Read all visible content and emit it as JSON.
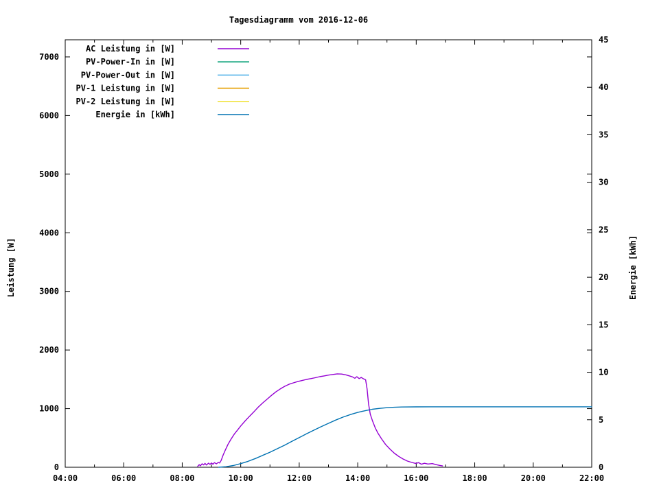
{
  "chart_data": {
    "type": "line",
    "title": "Tagesdiagramm vom 2016-12-06",
    "x_axis": {
      "range": [
        4,
        22
      ],
      "major_hours": [
        4,
        6,
        8,
        10,
        12,
        14,
        16,
        18,
        20,
        22
      ],
      "tick_labels": [
        "04:00",
        "06:00",
        "08:00",
        "10:00",
        "12:00",
        "14:00",
        "16:00",
        "18:00",
        "20:00",
        "22:00"
      ],
      "minor_hours": [
        5,
        7,
        9,
        11,
        13,
        15,
        17,
        19,
        21
      ]
    },
    "y_left": {
      "title": "Leistung [W]",
      "range": [
        0,
        7292
      ],
      "ticks": [
        0,
        1000,
        2000,
        3000,
        4000,
        5000,
        6000,
        7000
      ],
      "tick_labels": [
        "0",
        "1000",
        "2000",
        "3000",
        "4000",
        "5000",
        "6000",
        "7000"
      ]
    },
    "y_right": {
      "title": "Energie [kWh]",
      "range": [
        0,
        45
      ],
      "ticks": [
        0,
        5,
        10,
        15,
        20,
        25,
        30,
        35,
        40,
        45
      ],
      "tick_labels": [
        "0",
        "5",
        "10",
        "15",
        "20",
        "25",
        "30",
        "35",
        "40",
        "45"
      ]
    },
    "legend_position": "top-left-inside",
    "grid": false,
    "series": [
      {
        "name": "AC Leistung in [W]",
        "color": "#9400d3",
        "axis": "left",
        "points": [
          [
            8.53,
            15
          ],
          [
            8.58,
            45
          ],
          [
            8.62,
            25
          ],
          [
            8.68,
            60
          ],
          [
            8.73,
            40
          ],
          [
            8.78,
            65
          ],
          [
            8.83,
            38
          ],
          [
            8.9,
            70
          ],
          [
            8.95,
            48
          ],
          [
            9.0,
            72
          ],
          [
            9.05,
            50
          ],
          [
            9.1,
            78
          ],
          [
            9.17,
            58
          ],
          [
            9.23,
            82
          ],
          [
            9.28,
            72
          ],
          [
            9.33,
            115
          ],
          [
            9.4,
            210
          ],
          [
            9.48,
            300
          ],
          [
            9.57,
            395
          ],
          [
            9.67,
            480
          ],
          [
            9.78,
            565
          ],
          [
            9.9,
            640
          ],
          [
            10.0,
            705
          ],
          [
            10.15,
            790
          ],
          [
            10.3,
            870
          ],
          [
            10.45,
            945
          ],
          [
            10.6,
            1025
          ],
          [
            10.75,
            1095
          ],
          [
            10.9,
            1160
          ],
          [
            11.05,
            1225
          ],
          [
            11.2,
            1285
          ],
          [
            11.35,
            1335
          ],
          [
            11.5,
            1380
          ],
          [
            11.65,
            1415
          ],
          [
            11.8,
            1440
          ],
          [
            11.95,
            1462
          ],
          [
            12.1,
            1480
          ],
          [
            12.25,
            1498
          ],
          [
            12.4,
            1512
          ],
          [
            12.55,
            1528
          ],
          [
            12.7,
            1545
          ],
          [
            12.85,
            1558
          ],
          [
            13.0,
            1572
          ],
          [
            13.15,
            1583
          ],
          [
            13.3,
            1593
          ],
          [
            13.45,
            1590
          ],
          [
            13.6,
            1575
          ],
          [
            13.72,
            1558
          ],
          [
            13.82,
            1542
          ],
          [
            13.9,
            1518
          ],
          [
            13.97,
            1545
          ],
          [
            14.05,
            1512
          ],
          [
            14.12,
            1532
          ],
          [
            14.2,
            1508
          ],
          [
            14.27,
            1492
          ],
          [
            14.32,
            1340
          ],
          [
            14.37,
            1080
          ],
          [
            14.43,
            905
          ],
          [
            14.5,
            800
          ],
          [
            14.6,
            670
          ],
          [
            14.7,
            575
          ],
          [
            14.82,
            480
          ],
          [
            14.95,
            390
          ],
          [
            15.1,
            310
          ],
          [
            15.25,
            240
          ],
          [
            15.4,
            185
          ],
          [
            15.55,
            140
          ],
          [
            15.7,
            105
          ],
          [
            15.85,
            82
          ],
          [
            15.98,
            65
          ],
          [
            16.08,
            78
          ],
          [
            16.18,
            52
          ],
          [
            16.28,
            68
          ],
          [
            16.4,
            55
          ],
          [
            16.55,
            62
          ],
          [
            16.68,
            45
          ],
          [
            16.8,
            32
          ],
          [
            16.9,
            22
          ]
        ]
      },
      {
        "name": "PV-Power-In in [W]",
        "color": "#009e73",
        "axis": "left",
        "points": []
      },
      {
        "name": "PV-Power-Out in [W]",
        "color": "#56b4e9",
        "axis": "left",
        "points": []
      },
      {
        "name": "PV-1 Leistung in [W]",
        "color": "#e69f00",
        "axis": "left",
        "points": []
      },
      {
        "name": "PV-2 Leistung in [W]",
        "color": "#f0e442",
        "axis": "left",
        "points": []
      },
      {
        "name": "Energie in [kWh]",
        "color": "#0072b2",
        "axis": "right",
        "points": [
          [
            9.25,
            0
          ],
          [
            9.5,
            0.06
          ],
          [
            9.75,
            0.18
          ],
          [
            10.0,
            0.38
          ],
          [
            10.25,
            0.62
          ],
          [
            10.5,
            0.92
          ],
          [
            10.75,
            1.25
          ],
          [
            11.0,
            1.58
          ],
          [
            11.25,
            1.95
          ],
          [
            11.5,
            2.32
          ],
          [
            11.75,
            2.72
          ],
          [
            12.0,
            3.12
          ],
          [
            12.25,
            3.52
          ],
          [
            12.5,
            3.9
          ],
          [
            12.75,
            4.27
          ],
          [
            13.0,
            4.62
          ],
          [
            13.25,
            4.97
          ],
          [
            13.5,
            5.28
          ],
          [
            13.75,
            5.55
          ],
          [
            14.0,
            5.77
          ],
          [
            14.15,
            5.88
          ],
          [
            14.3,
            5.98
          ],
          [
            14.5,
            6.1
          ],
          [
            14.75,
            6.2
          ],
          [
            15.0,
            6.27
          ],
          [
            15.25,
            6.31
          ],
          [
            15.5,
            6.34
          ],
          [
            16.0,
            6.355
          ],
          [
            16.5,
            6.36
          ],
          [
            22.0,
            6.36
          ]
        ]
      }
    ]
  }
}
